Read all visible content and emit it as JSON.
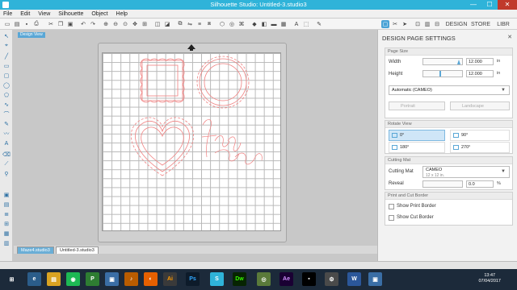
{
  "window": {
    "title": "Silhouette Studio: Untitled-3.studio3",
    "minimize": "—",
    "maximize": "☐",
    "close": "✕"
  },
  "menu": [
    "File",
    "Edit",
    "View",
    "Silhouette",
    "Object",
    "Help"
  ],
  "canvas": {
    "design_tag": "Design View"
  },
  "doc_tabs": [
    "Maze4.studio3",
    "Untitled-3.studio3"
  ],
  "panel": {
    "title": "DESIGN PAGE SETTINGS",
    "close": "✕",
    "page_size": {
      "header": "Page Size",
      "width_label": "Width",
      "width_value": "12.000",
      "width_unit": "in",
      "height_label": "Height",
      "height_value": "12.000",
      "height_unit": "in",
      "preset": "Automatic (CAMEO)",
      "portrait": "Portrait",
      "landscape": "Landscape"
    },
    "rotate_view": {
      "header": "Rotate View",
      "options": [
        "0°",
        "90°",
        "180°",
        "270°"
      ],
      "selected": "0°"
    },
    "cutting_mat": {
      "header": "Cutting Mat",
      "label": "Cutting Mat",
      "value": "CAMEO",
      "sub": "12 x 12 in.",
      "reveal_label": "Reveal",
      "reveal_value": "0.0",
      "reveal_unit": "%"
    },
    "print_cut": {
      "header": "Print and Cut Border",
      "show_print_border": "Show Print Border",
      "show_cut_border": "Show Cut Border"
    }
  },
  "taskbar": {
    "time": "13:47",
    "date": "07/04/2017",
    "apps": [
      "Ai",
      "Ps",
      "Dw",
      "Ae"
    ]
  },
  "colors": {
    "accent": "#2fb3d9",
    "shape_stroke": "#f08080",
    "taskbar": "#1c2a3a"
  }
}
